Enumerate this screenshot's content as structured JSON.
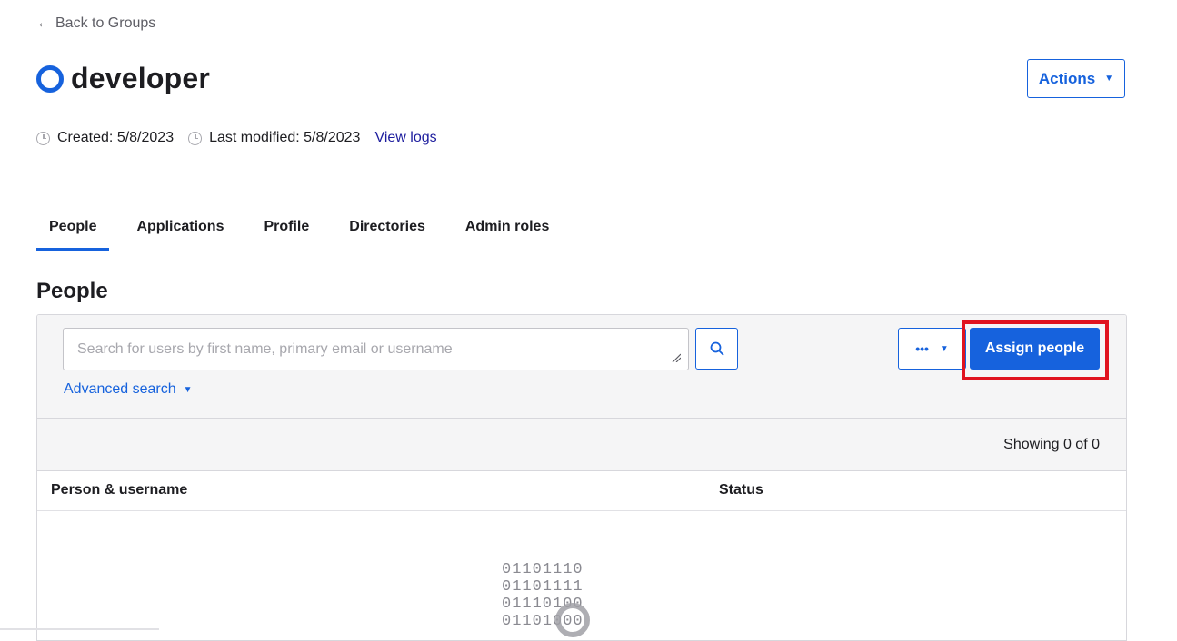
{
  "nav": {
    "back_arrow": "←",
    "back_label": "Back to Groups"
  },
  "group": {
    "icon": "group-ring-icon",
    "name": "developer"
  },
  "actions": {
    "label": "Actions",
    "caret": "▼"
  },
  "meta": {
    "created_label": "Created: 5/8/2023",
    "modified_label": "Last modified: 5/8/2023",
    "view_logs": "View logs"
  },
  "tabs": [
    {
      "label": "People",
      "active": true
    },
    {
      "label": "Applications",
      "active": false
    },
    {
      "label": "Profile",
      "active": false
    },
    {
      "label": "Directories",
      "active": false
    },
    {
      "label": "Admin roles",
      "active": false
    }
  ],
  "section": {
    "title": "People"
  },
  "search": {
    "placeholder": "Search for users by first name, primary email or username",
    "value": "",
    "advanced_label": "Advanced search",
    "advanced_caret": "▼"
  },
  "toolbar": {
    "more_label": "•••",
    "more_caret": "▼",
    "assign_label": "Assign people"
  },
  "results": {
    "showing": "Showing 0 of 0"
  },
  "table": {
    "columns": [
      "Person & username",
      "Status"
    ]
  },
  "loader": {
    "lines": [
      "01101110",
      "01101111",
      "01110100",
      "01101000"
    ]
  },
  "colors": {
    "accent": "#1662dd",
    "highlight": "#e0131f",
    "panel_bg": "#f5f5f6"
  }
}
